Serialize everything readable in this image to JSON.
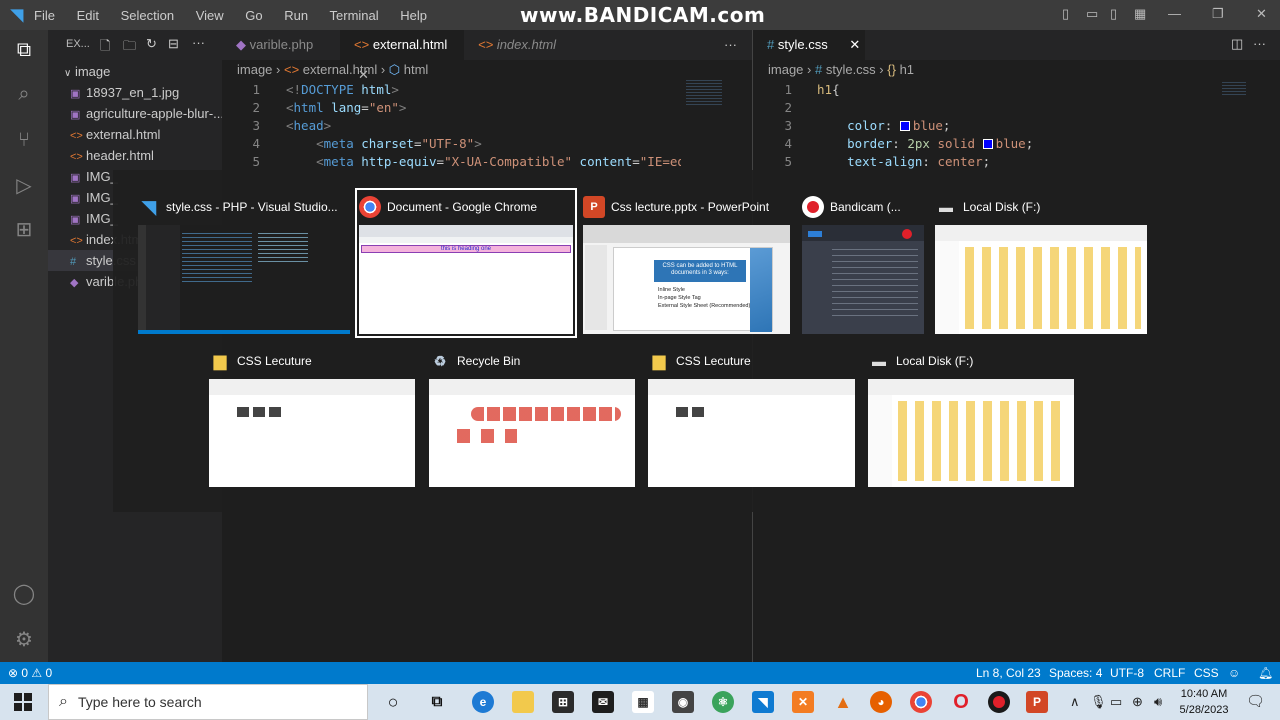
{
  "titlebar": {
    "menu": [
      "File",
      "Edit",
      "Selection",
      "View",
      "Go",
      "Run",
      "Terminal",
      "Help"
    ],
    "watermark": "www.BANDICAM.com"
  },
  "explorer": {
    "header": "EX...",
    "folder": "image",
    "files": [
      {
        "name": "18937_en_1.jpg",
        "type": "image"
      },
      {
        "name": "agriculture-apple-blur-...",
        "type": "image"
      },
      {
        "name": "external.html",
        "type": "html"
      },
      {
        "name": "header.html",
        "type": "html"
      },
      {
        "name": "IMG_",
        "type": "image"
      },
      {
        "name": "IMG_",
        "type": "image"
      },
      {
        "name": "IMG_",
        "type": "image"
      },
      {
        "name": "index.html",
        "type": "html"
      },
      {
        "name": "style.css",
        "type": "css"
      },
      {
        "name": "varible.php",
        "type": "php"
      }
    ]
  },
  "left_editor": {
    "tabs": [
      {
        "label": "varible.php",
        "active": false
      },
      {
        "label": "external.html",
        "active": true
      },
      {
        "label": "index.html",
        "active": false
      }
    ],
    "breadcrumb": [
      "image",
      "external.html",
      "html"
    ],
    "line_numbers": [
      "1",
      "2",
      "3",
      "4",
      "5"
    ]
  },
  "right_editor": {
    "tab": "style.css",
    "breadcrumb": [
      "image",
      "style.css",
      "h1"
    ],
    "line_numbers": [
      "1",
      "2",
      "3",
      "4",
      "5"
    ]
  },
  "switcher": {
    "row1": [
      {
        "title": "style.css - PHP - Visual Studio...",
        "icon": "vscode-icon"
      },
      {
        "title": "Document - Google Chrome",
        "icon": "chrome-icon",
        "focused": true
      },
      {
        "title": "Css lecture.pptx - PowerPoint",
        "icon": "powerpoint-icon"
      },
      {
        "title": "Bandicam (...",
        "icon": "bandicam-icon"
      },
      {
        "title": "Local Disk (F:)",
        "icon": "drive-icon"
      }
    ],
    "row2": [
      {
        "title": "CSS Lecuture",
        "icon": "folder-icon"
      },
      {
        "title": "Recycle Bin",
        "icon": "recycle-bin-icon"
      },
      {
        "title": "CSS Lecuture",
        "icon": "folder-icon"
      },
      {
        "title": "Local Disk (F:)",
        "icon": "drive-icon"
      }
    ],
    "chrome_banner": "this is heading one",
    "ppt_text": "CSS can be added to HTML documents in 3 ways:",
    "ppt_bullets": [
      "Inline Style",
      "In-page Style Tag",
      "External Style Sheet (Recommended)"
    ]
  },
  "statusbar": {
    "problems": "⊗ 0 ⚠ 0",
    "position": "Ln 8, Col 23",
    "spaces": "Spaces: 4",
    "encoding": "UTF-8",
    "eol": "CRLF",
    "language": "CSS"
  },
  "taskbar": {
    "search_placeholder": "Type here to search",
    "time": "10:40 AM",
    "date": "5/28/2023"
  },
  "colors": {
    "statusbar": "#007acc",
    "editor_bg": "#1e1e1e",
    "sidebar_bg": "#252526"
  }
}
